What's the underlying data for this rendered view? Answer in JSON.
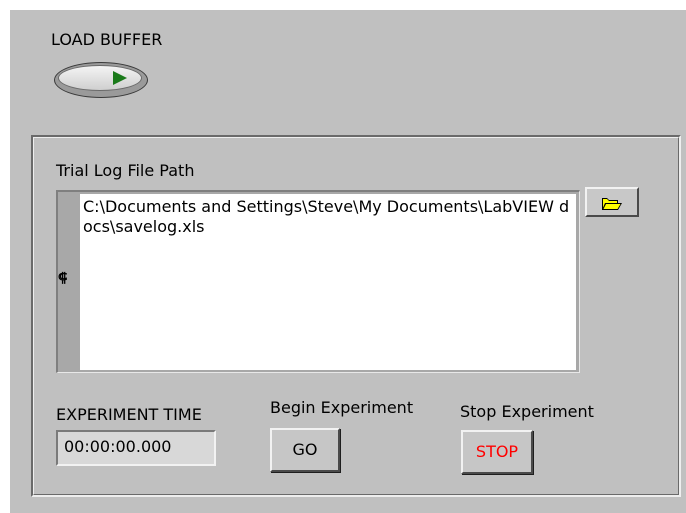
{
  "load_buffer": {
    "label": "LOAD BUFFER",
    "button_icon": "play-arrow-icon"
  },
  "trial_log": {
    "label": "Trial Log File Path",
    "path_value": "C:\\Documents and Settings\\Steve\\My Documents\\LabVIEW docs\\savelog.xls",
    "browse_icon": "folder-open-icon",
    "path_type_glyph": "⸿"
  },
  "experiment_time": {
    "label": "EXPERIMENT TIME",
    "value": "00:00:00.000"
  },
  "begin_experiment": {
    "label": "Begin Experiment",
    "button_text": "GO"
  },
  "stop_experiment": {
    "label": "Stop Experiment",
    "button_text": "STOP",
    "button_text_color": "#ff0000"
  },
  "colors": {
    "panel_background": "#c0c0c0",
    "arrow_green": "#1a7a1a",
    "folder_yellow": "#ffff00"
  }
}
